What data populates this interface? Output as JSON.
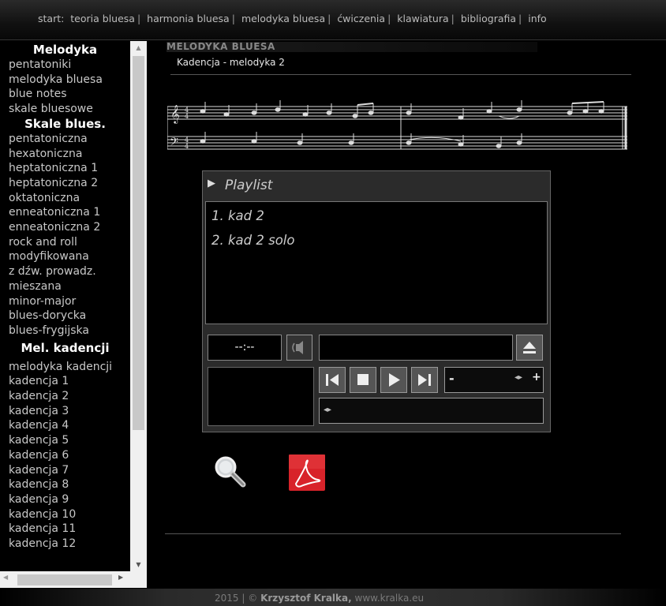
{
  "nav": {
    "prefix": "start:",
    "items": [
      "teoria bluesa",
      "harmonia bluesa",
      "melodyka bluesa",
      "ćwiczenia",
      "klawiatura",
      "bibliografia",
      "info"
    ],
    "sep": "|"
  },
  "sidebar": {
    "groups": [
      {
        "header": "Melodyka",
        "items": [
          "pentatoniki",
          "melodyka bluesa",
          "blue notes",
          "skale bluesowe"
        ]
      },
      {
        "header": "Skale blues.",
        "items": [
          "pentatoniczna",
          "hexatoniczna",
          "heptatoniczna 1",
          "heptatoniczna 2",
          "oktatoniczna",
          "enneatoniczna 1",
          "enneatoniczna 2",
          "rock and roll",
          "modyfikowana",
          "z dźw. prowadz.",
          "mieszana",
          "minor-major",
          "blues-dorycka",
          "blues-frygijska"
        ]
      },
      {
        "header": "Mel. kadencji",
        "items": [
          "melodyka kadencji",
          "kadencja 1",
          "kadencja 2",
          "kadencja 3",
          "kadencja 4",
          "kadencja 5",
          "kadencja 6",
          "kadencja 7",
          "kadencja 8",
          "kadencja 9",
          "kadencja 10",
          "kadencja 11",
          "kadencja 12"
        ]
      }
    ]
  },
  "main": {
    "section_title": "MELODYKA BLUESA",
    "page_title": "Kadencja - melodyka 2"
  },
  "player": {
    "playlist_label": "Playlist",
    "tracks": [
      "1. kad 2",
      "2. kad 2 solo"
    ],
    "time": "--:--",
    "volume_minus": "-",
    "volume_plus": "+"
  },
  "footer": {
    "year": "2015",
    "sep": "|",
    "copy": "©",
    "author": "Krzysztof Kralka,",
    "site": "www.kralka.eu"
  },
  "colors": {
    "background": "#000000",
    "panel": "#2b2b2b",
    "pdf_red": "#d8232a"
  }
}
